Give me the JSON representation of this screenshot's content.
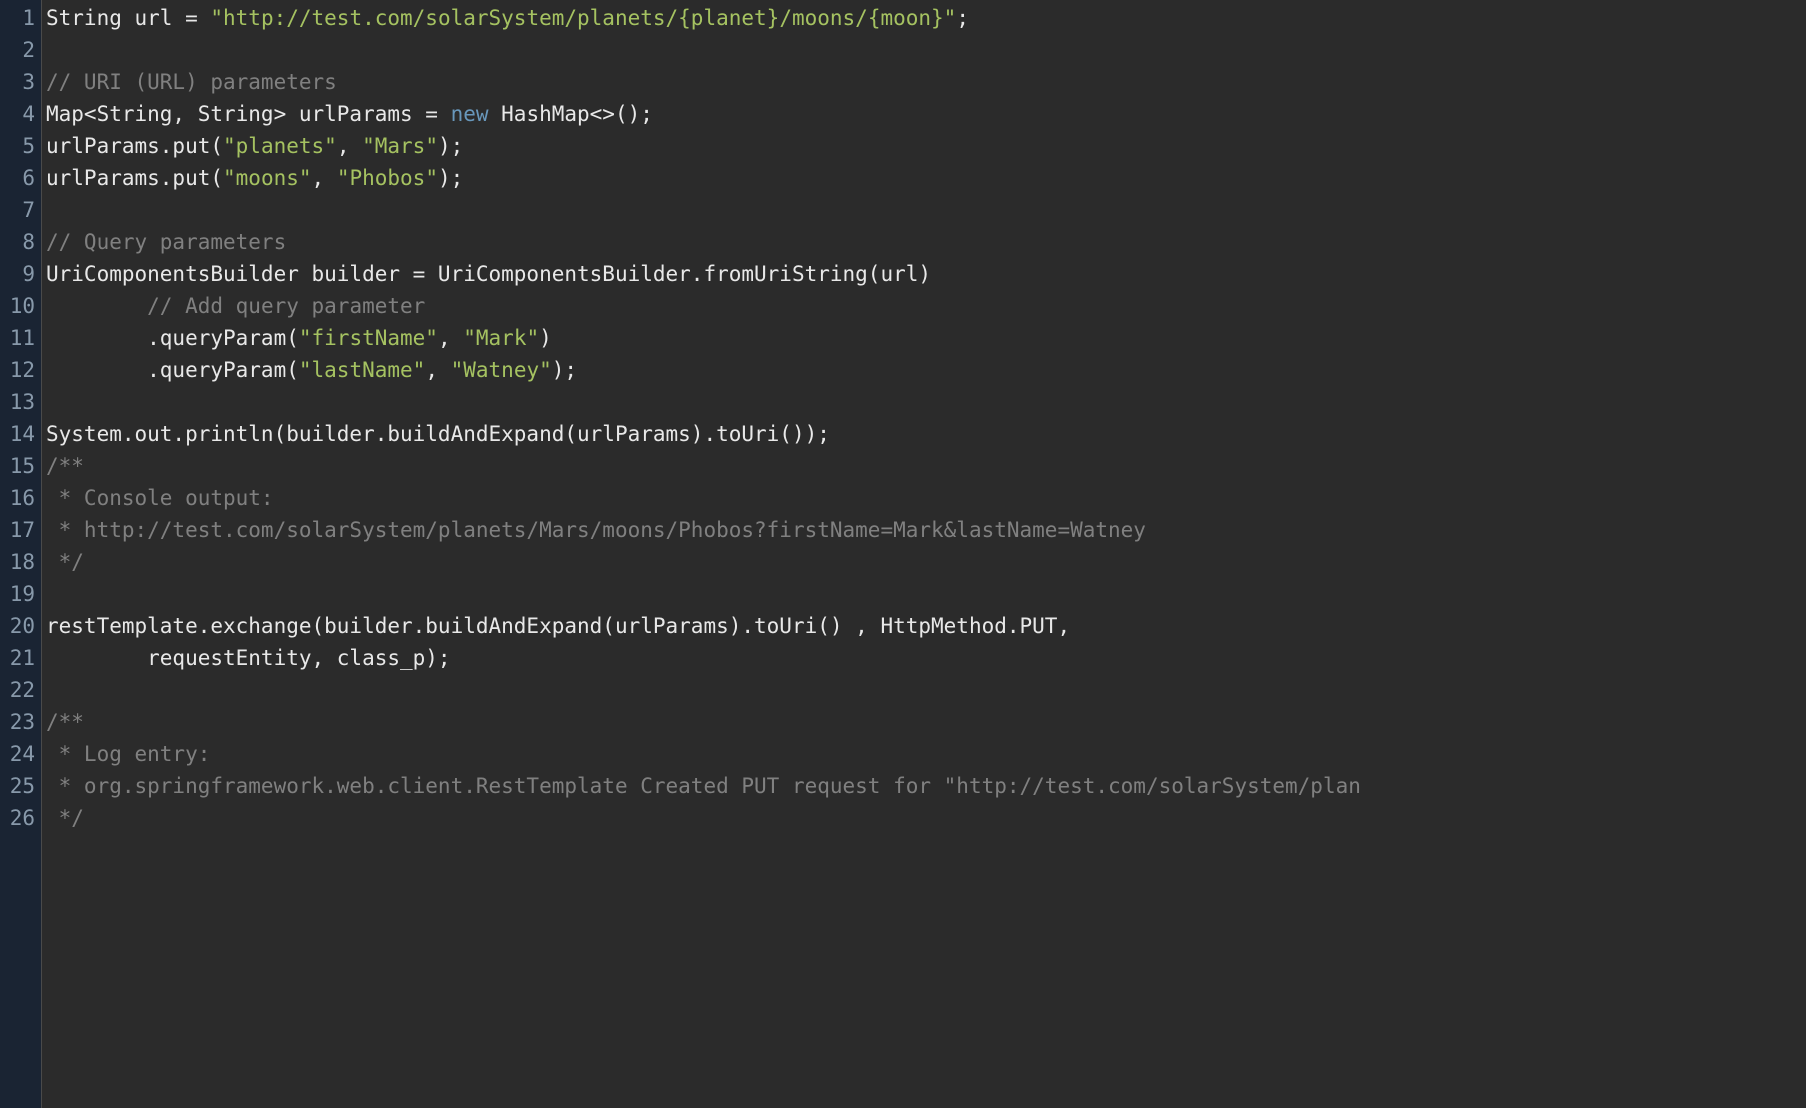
{
  "lines": [
    {
      "num": "1",
      "segments": [
        {
          "t": "String url = ",
          "c": "w"
        },
        {
          "t": "\"http://test.com/solarSystem/planets/{planet}/moons/{moon}\"",
          "c": "str"
        },
        {
          "t": ";",
          "c": "w"
        }
      ]
    },
    {
      "num": "2",
      "segments": []
    },
    {
      "num": "3",
      "segments": [
        {
          "t": "// URI (URL) parameters",
          "c": "comm"
        }
      ]
    },
    {
      "num": "4",
      "segments": [
        {
          "t": "Map<String, String> urlParams = ",
          "c": "w"
        },
        {
          "t": "new",
          "c": "kw"
        },
        {
          "t": " HashMap<>();",
          "c": "w"
        }
      ]
    },
    {
      "num": "5",
      "segments": [
        {
          "t": "urlParams.put(",
          "c": "w"
        },
        {
          "t": "\"planets\"",
          "c": "str"
        },
        {
          "t": ", ",
          "c": "w"
        },
        {
          "t": "\"Mars\"",
          "c": "str"
        },
        {
          "t": ");",
          "c": "w"
        }
      ]
    },
    {
      "num": "6",
      "segments": [
        {
          "t": "urlParams.put(",
          "c": "w"
        },
        {
          "t": "\"moons\"",
          "c": "str"
        },
        {
          "t": ", ",
          "c": "w"
        },
        {
          "t": "\"Phobos\"",
          "c": "str"
        },
        {
          "t": ");",
          "c": "w"
        }
      ]
    },
    {
      "num": "7",
      "segments": []
    },
    {
      "num": "8",
      "segments": [
        {
          "t": "// Query parameters",
          "c": "comm"
        }
      ]
    },
    {
      "num": "9",
      "segments": [
        {
          "t": "UriComponentsBuilder builder = UriComponentsBuilder.fromUriString(url)",
          "c": "w"
        }
      ]
    },
    {
      "num": "10",
      "segments": [
        {
          "t": "        ",
          "c": "w"
        },
        {
          "t": "// Add query parameter",
          "c": "comm"
        }
      ]
    },
    {
      "num": "11",
      "segments": [
        {
          "t": "        .queryParam(",
          "c": "w"
        },
        {
          "t": "\"firstName\"",
          "c": "str"
        },
        {
          "t": ", ",
          "c": "w"
        },
        {
          "t": "\"Mark\"",
          "c": "str"
        },
        {
          "t": ")",
          "c": "w"
        }
      ]
    },
    {
      "num": "12",
      "segments": [
        {
          "t": "        .queryParam(",
          "c": "w"
        },
        {
          "t": "\"lastName\"",
          "c": "str"
        },
        {
          "t": ", ",
          "c": "w"
        },
        {
          "t": "\"Watney\"",
          "c": "str"
        },
        {
          "t": ");",
          "c": "w"
        }
      ]
    },
    {
      "num": "13",
      "segments": []
    },
    {
      "num": "14",
      "segments": [
        {
          "t": "System.out.println(builder.buildAndExpand(urlParams).toUri());",
          "c": "w"
        }
      ]
    },
    {
      "num": "15",
      "segments": [
        {
          "t": "/**",
          "c": "comm"
        }
      ]
    },
    {
      "num": "16",
      "segments": [
        {
          "t": " * Console output:",
          "c": "comm"
        }
      ]
    },
    {
      "num": "17",
      "segments": [
        {
          "t": " * http://test.com/solarSystem/planets/Mars/moons/Phobos?firstName=Mark&lastName=Watney",
          "c": "comm"
        }
      ]
    },
    {
      "num": "18",
      "segments": [
        {
          "t": " */",
          "c": "comm"
        }
      ]
    },
    {
      "num": "19",
      "segments": []
    },
    {
      "num": "20",
      "segments": [
        {
          "t": "restTemplate.exchange(builder.buildAndExpand(urlParams).toUri() , HttpMethod.PUT,",
          "c": "w"
        }
      ]
    },
    {
      "num": "21",
      "segments": [
        {
          "t": "        requestEntity, class_p);",
          "c": "w"
        }
      ]
    },
    {
      "num": "22",
      "segments": []
    },
    {
      "num": "23",
      "segments": [
        {
          "t": "/**",
          "c": "comm"
        }
      ]
    },
    {
      "num": "24",
      "segments": [
        {
          "t": " * Log entry:",
          "c": "comm"
        }
      ]
    },
    {
      "num": "25",
      "segments": [
        {
          "t": " * org.springframework.web.client.RestTemplate Created PUT request for \"http://test.com/solarSystem/plan",
          "c": "comm"
        }
      ]
    },
    {
      "num": "26",
      "segments": [
        {
          "t": " */",
          "c": "comm"
        }
      ]
    }
  ]
}
